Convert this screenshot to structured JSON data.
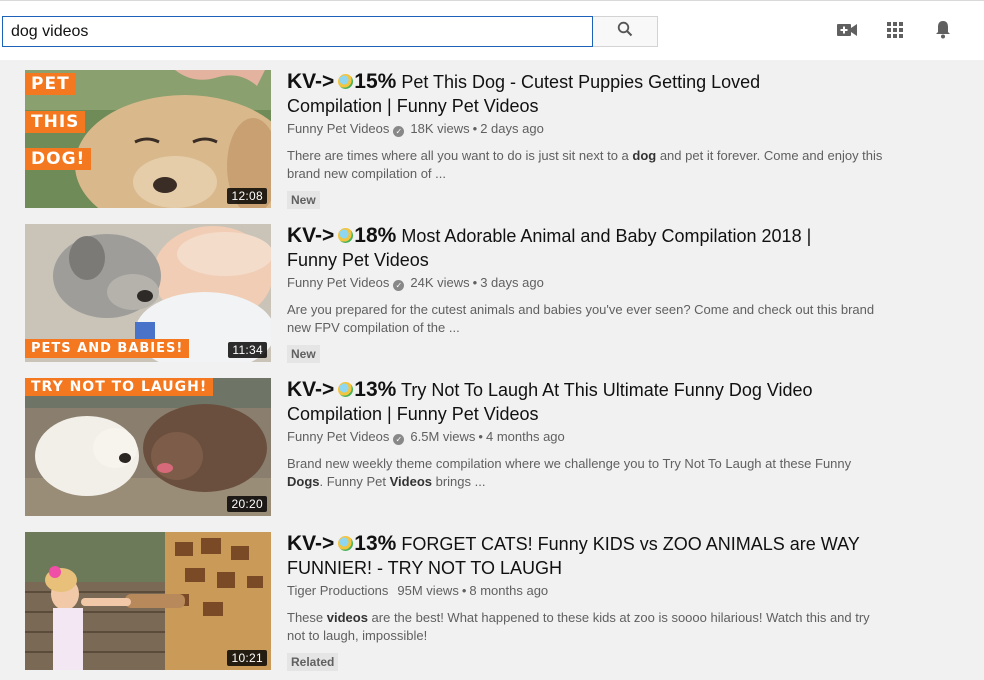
{
  "search": {
    "query": "dog videos"
  },
  "results": [
    {
      "kv": "KV->",
      "pct": "15%",
      "title_line1": "Pet This Dog - Cutest Puppies Getting Loved",
      "title_line2": "Compilation | Funny Pet Videos",
      "channel": "Funny Pet Videos",
      "views": "18K views",
      "age": "2 days ago",
      "desc_a": "There are times where all you want to do is just sit next to a ",
      "desc_b": "dog",
      "desc_c": " and pet it forever. Come and enjoy this brand new compilation of ...",
      "badge": "New",
      "duration": "12:08",
      "overlay": [
        "PET",
        "THIS",
        "DOG!"
      ]
    },
    {
      "kv": "KV->",
      "pct": "18%",
      "title_line1": "Most Adorable Animal and Baby Compilation 2018 |",
      "title_line2": "Funny Pet Videos",
      "channel": "Funny Pet Videos",
      "views": "24K views",
      "age": "3 days ago",
      "desc_a": "Are you prepared for the cutest animals and babies you've ever seen? Come and check out this brand new FPV compilation of the ...",
      "desc_b": "",
      "desc_c": "",
      "badge": "New",
      "duration": "11:34",
      "overlay": [
        "PETS AND BABIES!"
      ]
    },
    {
      "kv": "KV->",
      "pct": "13%",
      "title_line1": "Try Not To Laugh At This Ultimate Funny Dog Video",
      "title_line2": "Compilation | Funny Pet Videos",
      "channel": "Funny Pet Videos",
      "views": "6.5M views",
      "age": "4 months ago",
      "desc_a": "Brand new weekly theme compilation where we challenge you to Try Not To Laugh at these Funny ",
      "desc_b": "Dogs",
      "desc_c": ". Funny Pet ",
      "desc_d": "Videos",
      "desc_e": " brings ...",
      "badge": "",
      "duration": "20:20",
      "overlay": [
        "TRY NOT TO LAUGH!"
      ]
    },
    {
      "kv": "KV->",
      "pct": "13%",
      "title_line1": "FORGET CATS! Funny KIDS vs ZOO ANIMALS are WAY",
      "title_line2": "FUNNIER! - TRY NOT TO LAUGH",
      "channel": "Tiger Productions",
      "views": "95M views",
      "age": "8 months ago",
      "desc_a": "These ",
      "desc_b": "videos",
      "desc_c": " are the best! What happened to these kids at zoo is soooo hilarious! Watch this and try not to laugh, impossible!",
      "badge": "Related",
      "duration": "10:21",
      "overlay": []
    }
  ],
  "colors": {
    "accent_border": "#1c62b9",
    "thumb_label_bg": "#f4781f"
  },
  "icons": [
    "search-icon",
    "video-camera-add-icon",
    "apps-grid-icon",
    "notifications-bell-icon",
    "verified-badge-icon"
  ]
}
